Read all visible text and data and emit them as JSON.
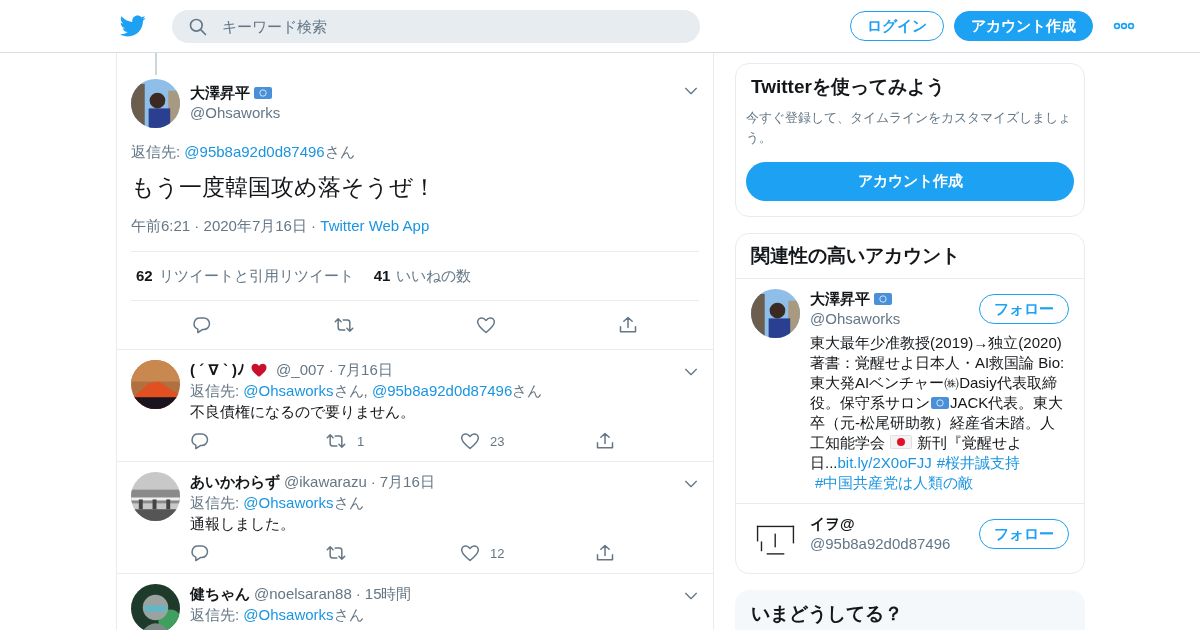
{
  "header": {
    "search": {
      "placeholder": "キーワード検索"
    },
    "buttons": [
      {
        "label": "ログイン",
        "kind": "outline"
      },
      {
        "label": "アカウント作成",
        "kind": "filled"
      }
    ]
  },
  "main_tweet": {
    "name": "大澤昇平",
    "badge": true,
    "handle": "@Ohsaworks",
    "reply_to": [
      {
        "text": "返信先: ",
        "kind": "plain"
      },
      {
        "text": "@95b8a92d0d87496",
        "kind": "link"
      },
      {
        "text": "さん",
        "kind": "plain"
      }
    ],
    "text": "もう一度韓国攻め落そうぜ！",
    "meta": [
      {
        "text": "午前6:21",
        "kind": "plain"
      },
      {
        "text": "·",
        "kind": "separator"
      },
      {
        "text": "2020年7月16日",
        "kind": "plain"
      },
      {
        "text": "·",
        "kind": "separator"
      },
      {
        "text": "Twitter Web App",
        "kind": "link"
      }
    ],
    "stats": [
      {
        "count": "62",
        "label": "リツイートと引用リツイート"
      },
      {
        "count": "41",
        "label": "いいねの数"
      }
    ]
  },
  "replies": [
    {
      "name": "( ´ ∇ ` )ﾉ",
      "heart": true,
      "handle": "@_007",
      "separator": "·",
      "date": "7月16日",
      "reply_to": [
        {
          "text": "返信先: ",
          "kind": "plain"
        },
        {
          "text": "@Ohsaworks",
          "kind": "link"
        },
        {
          "text": "さん, ",
          "kind": "plain"
        },
        {
          "text": "@95b8a92d0d87496",
          "kind": "link"
        },
        {
          "text": "さん",
          "kind": "plain"
        }
      ],
      "text": "不良債権になるので要りません。",
      "retweets": "1",
      "likes": "23"
    },
    {
      "name": "あいかわらず",
      "heart": false,
      "handle": "@ikawarazu",
      "separator": "·",
      "date": "7月16日",
      "reply_to": [
        {
          "text": "返信先: ",
          "kind": "plain"
        },
        {
          "text": "@Ohsaworks",
          "kind": "link"
        },
        {
          "text": "さん",
          "kind": "plain"
        }
      ],
      "text": "通報しました。",
      "likes": "12"
    },
    {
      "name": "健ちゃん",
      "heart": false,
      "handle": "@noelsaran88",
      "separator": "·",
      "date": "15時間",
      "reply_to": [
        {
          "text": "返信先: ",
          "kind": "plain"
        },
        {
          "text": "@Ohsaworks",
          "kind": "link"
        },
        {
          "text": "さん",
          "kind": "plain"
        }
      ]
    }
  ],
  "sidebar": {
    "signup": {
      "title": "Twitterを使ってみよう",
      "text": "今すぐ登録して、タイムラインをカスタマイズしましょう。",
      "button": "アカウント作成"
    },
    "related": {
      "title": "関連性の高いアカウント",
      "accounts": [
        {
          "name": "大澤昇平",
          "badge": true,
          "handle": "@Ohsaworks",
          "follow": "フォロー",
          "bio": [
            {
              "kind": "text",
              "text": "東大最年少准教授(2019)→独立(2020)　 著書：覚醒せよ日本人・AI救国論 Bio: 東大発AIベンチャー㈱Dasiy代表取締役。保守系サロン"
            },
            {
              "kind": "badge"
            },
            {
              "kind": "text",
              "text": "JACK代表。東大卒（元-松尾研助教）経産省未踏。人工知能学会 "
            },
            {
              "kind": "flag"
            },
            {
              "kind": "text",
              "text": " 新刊『覚醒せよ日..."
            },
            {
              "kind": "link",
              "text": "bit.ly/2X0oFJJ"
            },
            {
              "kind": "link",
              "text": "#桜井誠支持"
            },
            {
              "kind": "link",
              "text": "#中国共産党は人類の敵"
            }
          ]
        },
        {
          "name": "イヲ@",
          "badge": false,
          "handle": "@95b8a92d0d87496",
          "follow": "フォロー"
        }
      ]
    },
    "trends": {
      "title": "いまどうしてる？"
    }
  }
}
